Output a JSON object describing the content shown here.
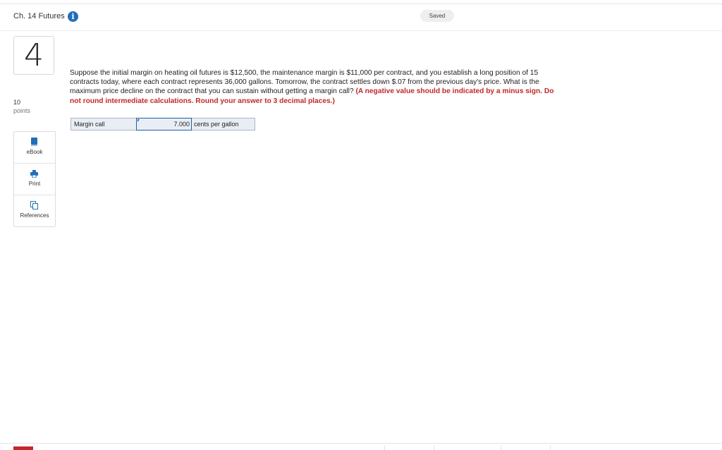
{
  "header": {
    "chapter_title": "Ch. 14 Futures",
    "info_icon": "info-icon",
    "status": "Saved"
  },
  "question": {
    "number": "4",
    "points_value": "10",
    "points_label": "points",
    "text": "Suppose the initial margin on heating oil futures is $12,500, the maintenance margin is $11,000 per contract, and you establish a long position of 15 contracts today, where each contract represents 36,000 gallons. Tomorrow, the contract settles down $.07 from the previous day's price. What is the maximum price decline on the contract that you can sustain without getting a margin call?",
    "instructions": "(A negative value should be indicated by a minus sign. Do not round intermediate calculations. Round your answer to 3 decimal places.)"
  },
  "tools": [
    {
      "label": "eBook",
      "icon": "book-icon"
    },
    {
      "label": "Print",
      "icon": "printer-icon"
    },
    {
      "label": "References",
      "icon": "references-icon"
    }
  ],
  "answer": {
    "label": "Margin call",
    "value": "7.000",
    "unit": "cents per gallon"
  },
  "colors": {
    "accent_blue": "#1f6fb8",
    "instruction_red": "#c0282d",
    "input_border": "#1d5fa6"
  }
}
